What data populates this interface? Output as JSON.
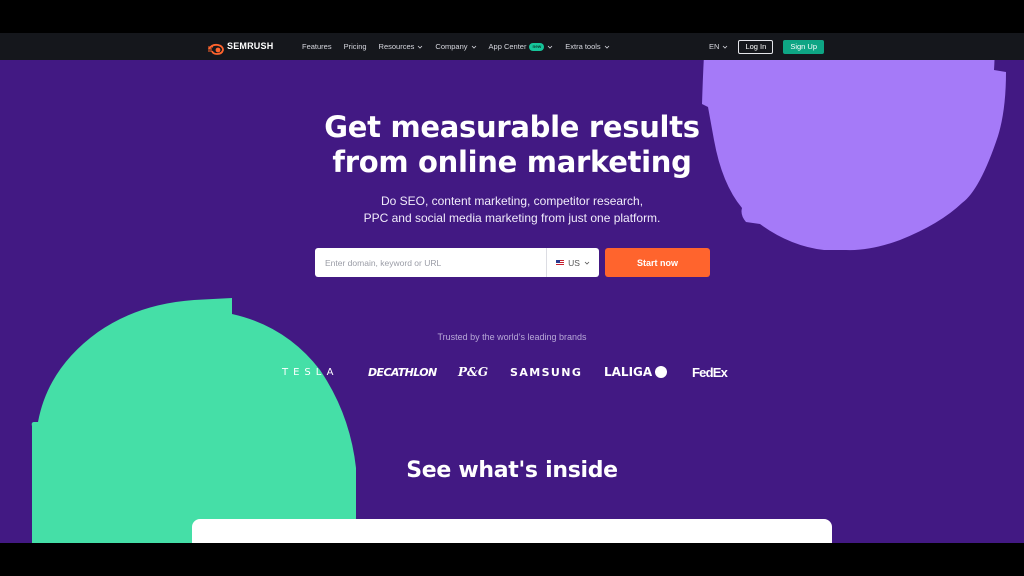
{
  "brand": {
    "name": "SEMRUSH",
    "colors": {
      "accent": "#ff642d",
      "hero_bg": "#421983",
      "nav_bg": "#15171c",
      "signup": "#0ea584",
      "purple_shape": "#a57af8",
      "green_shape": "#45dfa7"
    }
  },
  "nav": {
    "items": [
      {
        "label": "Features",
        "dropdown": false
      },
      {
        "label": "Pricing",
        "dropdown": false
      },
      {
        "label": "Resources",
        "dropdown": true
      },
      {
        "label": "Company",
        "dropdown": true
      },
      {
        "label": "App Center",
        "dropdown": true,
        "badge": "new"
      },
      {
        "label": "Extra tools",
        "dropdown": true
      }
    ],
    "language": "EN",
    "login_label": "Log In",
    "signup_label": "Sign Up"
  },
  "hero": {
    "headline_line1": "Get measurable results",
    "headline_line2": "from online marketing",
    "sub_line1": "Do SEO, content marketing, competitor research,",
    "sub_line2": "PPC and social media marketing from just one platform.",
    "search_placeholder": "Enter domain, keyword or URL",
    "country": "US",
    "start_label": "Start now"
  },
  "trusted": {
    "label": "Trusted by the world’s leading brands",
    "brands": [
      "TESLA",
      "DECATHLON",
      "P&G",
      "SAMSUNG",
      "LALIGA",
      "FedEx"
    ]
  },
  "inside": {
    "title": "See what's inside"
  },
  "icons": [
    "semrush-logo-icon",
    "chevron-down-icon",
    "us-flag-icon"
  ]
}
